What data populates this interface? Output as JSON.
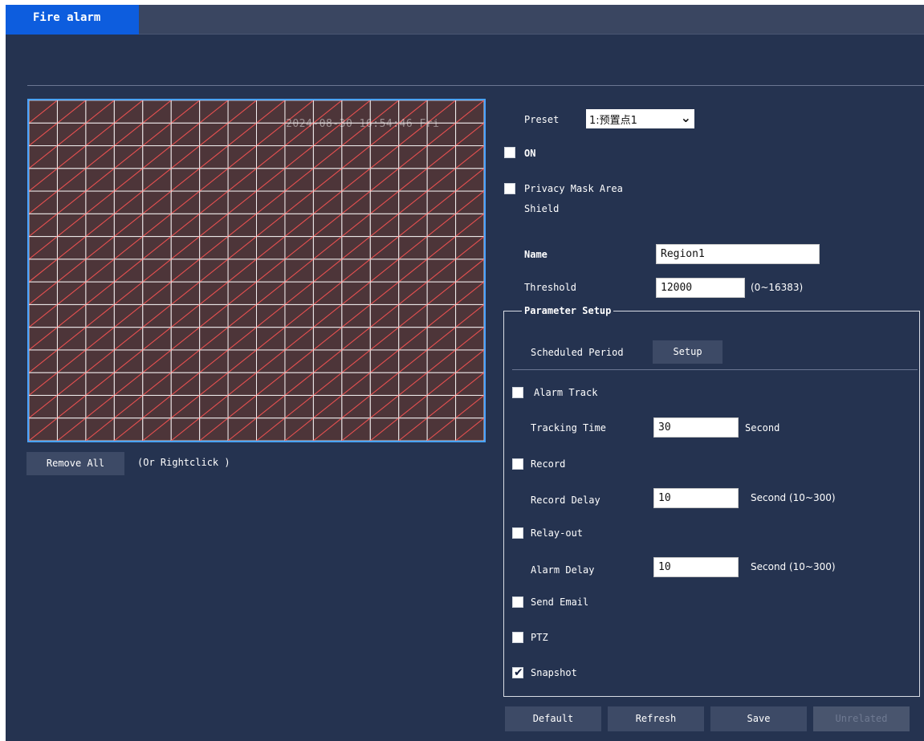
{
  "tab": {
    "label": "Fire alarm"
  },
  "video": {
    "osd_text": "2024-08-30 16:54:46 Fri"
  },
  "left_controls": {
    "remove_all_label": "Remove All",
    "hint": "(Or Rightclick )"
  },
  "preset": {
    "label": "Preset",
    "value": "1:预置点1"
  },
  "on": {
    "label": "ON",
    "checked": false
  },
  "privacy": {
    "label_line1": "Privacy Mask Area",
    "label_line2": "Shield",
    "checked": false
  },
  "name": {
    "label": "Name",
    "value": "Region1"
  },
  "threshold": {
    "label": "Threshold",
    "value": "12000",
    "range": "(0~16383)"
  },
  "parameter_setup": {
    "legend": "Parameter Setup",
    "scheduled_period_label": "Scheduled Period",
    "setup_label": "Setup",
    "alarm_track": {
      "label": "Alarm Track",
      "checked": false
    },
    "tracking_time": {
      "label": "Tracking Time",
      "value": "30",
      "unit": "Second"
    },
    "record": {
      "label": "Record",
      "checked": false
    },
    "record_delay": {
      "label": "Record Delay",
      "value": "10",
      "unit": "Second (10~300)"
    },
    "relay_out": {
      "label": "Relay-out",
      "checked": false
    },
    "alarm_delay": {
      "label": "Alarm Delay",
      "value": "10",
      "unit": "Second (10~300)"
    },
    "send_email": {
      "label": "Send Email",
      "checked": false
    },
    "ptz": {
      "label": "PTZ",
      "checked": false
    },
    "snapshot": {
      "label": "Snapshot",
      "checked": true
    }
  },
  "footer": {
    "default_label": "Default",
    "refresh_label": "Refresh",
    "save_label": "Save",
    "unrelated_label": "Unrelated"
  },
  "colors": {
    "background": "#253350",
    "tab_active": "#0d5dde",
    "grid_line": "#e65050",
    "selection_border": "#4aa3ff"
  }
}
